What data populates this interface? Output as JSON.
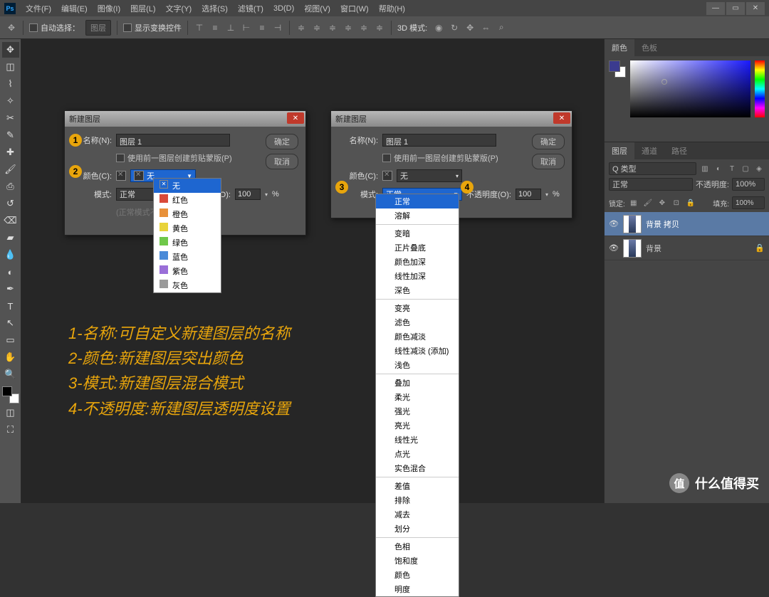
{
  "menubar": {
    "items": [
      "文件(F)",
      "编辑(E)",
      "图像(I)",
      "图层(L)",
      "文字(Y)",
      "选择(S)",
      "滤镜(T)",
      "3D(D)",
      "视图(V)",
      "窗口(W)",
      "帮助(H)"
    ]
  },
  "optbar": {
    "auto_select": "自动选择：",
    "layer_drop": "图层",
    "show_transform": "显示变换控件",
    "mode3d": "3D 模式:"
  },
  "right": {
    "tabs_color": [
      "颜色",
      "色板"
    ],
    "tabs_layers": [
      "图层",
      "通道",
      "路径"
    ],
    "kind": "Q 类型",
    "blend": "正常",
    "opacity_label": "不透明度:",
    "opacity_val": "100%",
    "lock": "锁定:",
    "fill_label": "填充:",
    "fill_val": "100%",
    "layers": [
      {
        "name": "背景 拷贝",
        "locked": false,
        "selected": true
      },
      {
        "name": "背景",
        "locked": true,
        "selected": false
      }
    ]
  },
  "dialog": {
    "title": "新建图层",
    "name_label": "名称(N):",
    "name_val": "图层 1",
    "prev_mask": "使用前一图层创建剪贴蒙版(P)",
    "color_label": "颜色(C):",
    "color_val": "无",
    "mode_label": "模式:",
    "mode_val": "正常",
    "opacity_label": "不透明度(O):",
    "opacity_val": "100",
    "pct": "%",
    "neutral": "(正常模式不存在中性色。)",
    "ok": "确定",
    "cancel": "取消"
  },
  "color_dd": {
    "selected": "无",
    "items": [
      {
        "label": "无",
        "color": null
      },
      {
        "label": "红色",
        "color": "#d94a3a"
      },
      {
        "label": "橙色",
        "color": "#e8913a"
      },
      {
        "label": "黄色",
        "color": "#e8d33a"
      },
      {
        "label": "绿色",
        "color": "#6fc84a"
      },
      {
        "label": "蓝色",
        "color": "#4a8ad8"
      },
      {
        "label": "紫色",
        "color": "#9a6fd8"
      },
      {
        "label": "灰色",
        "color": "#9a9a9a"
      }
    ]
  },
  "mode_dd": {
    "selected": "正常",
    "groups": [
      [
        "正常",
        "溶解"
      ],
      [
        "变暗",
        "正片叠底",
        "颜色加深",
        "线性加深",
        "深色"
      ],
      [
        "变亮",
        "滤色",
        "颜色减淡",
        "线性减淡 (添加)",
        "浅色"
      ],
      [
        "叠加",
        "柔光",
        "强光",
        "亮光",
        "线性光",
        "点光",
        "实色混合"
      ],
      [
        "差值",
        "排除",
        "减去",
        "划分"
      ],
      [
        "色相",
        "饱和度",
        "颜色",
        "明度"
      ]
    ]
  },
  "anno": {
    "l1": "1-名称:可自定义新建图层的名称",
    "l2": "2-颜色:新建图层突出颜色",
    "l3": "3-模式:新建图层混合模式",
    "l4": "4-不透明度:新建图层透明度设置"
  },
  "watermark": "什么值得买",
  "wm_icon": "值"
}
